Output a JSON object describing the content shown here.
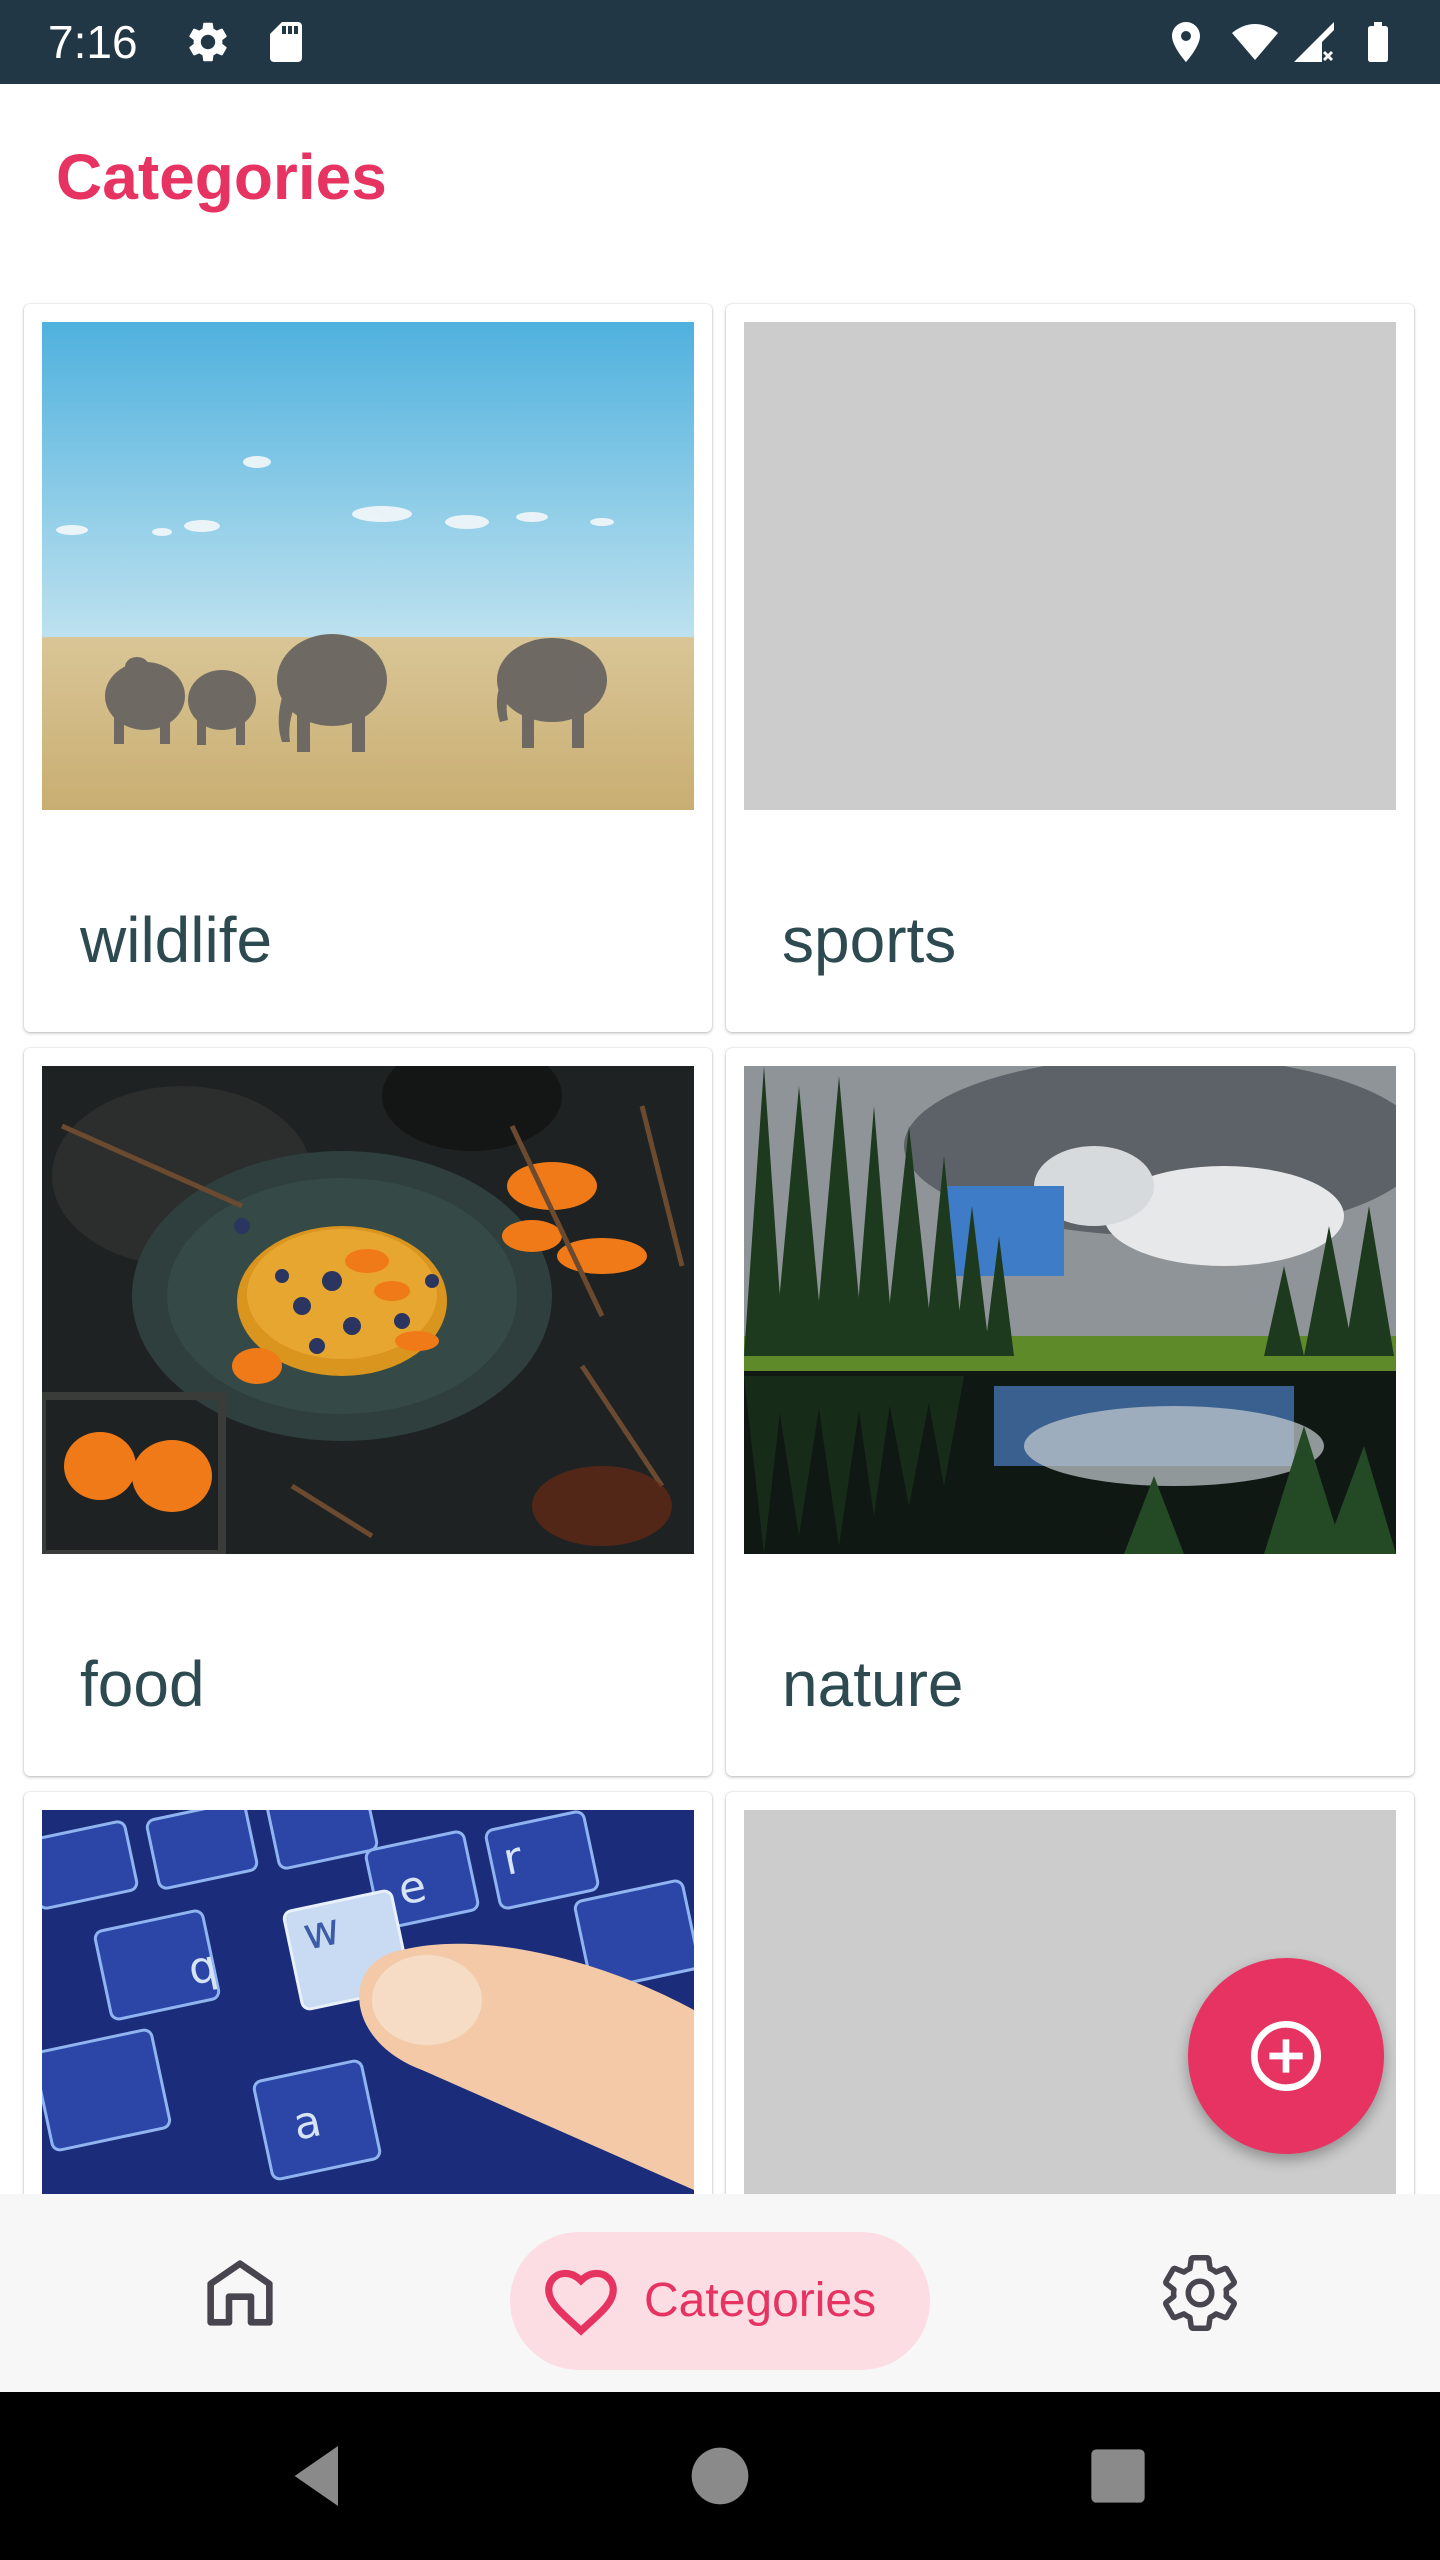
{
  "status_bar": {
    "time": "7:16",
    "icons": [
      "gear-icon",
      "sd-card-icon",
      "location-icon",
      "wifi-icon",
      "signal-icon",
      "battery-icon"
    ]
  },
  "header": {
    "title": "Categories"
  },
  "categories": [
    {
      "label": "wildlife",
      "image": "elephants-savanna"
    },
    {
      "label": "sports",
      "image": "placeholder"
    },
    {
      "label": "food",
      "image": "pancakes-oranges"
    },
    {
      "label": "nature",
      "image": "forest-lake"
    },
    {
      "label": "",
      "image": "keyboard-finger"
    },
    {
      "label": "",
      "image": "placeholder"
    }
  ],
  "fab": {
    "icon": "add-circle-icon"
  },
  "bottom_nav": {
    "items": [
      {
        "icon": "home-icon",
        "label": ""
      },
      {
        "icon": "heart-icon",
        "label": "Categories",
        "selected": true
      },
      {
        "icon": "settings-icon",
        "label": ""
      }
    ]
  },
  "system_nav": {
    "icons": [
      "back-icon",
      "home-circle-icon",
      "recents-icon"
    ]
  },
  "colors": {
    "accent": "#E63362",
    "status_bar": "#223746",
    "label_text": "#2C4A50",
    "nav_pill": "#FCDDE4",
    "placeholder": "#CCCCCC"
  }
}
